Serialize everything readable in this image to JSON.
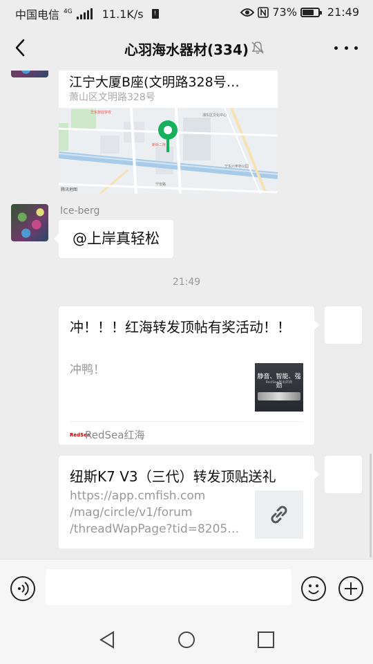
{
  "status_bar": {
    "carrier": "中国电信",
    "network_type": "4G",
    "speed": "11.1K/s",
    "battery": "73%",
    "battery_level": 0.73,
    "time": "21:49",
    "icons": [
      "signal-icon",
      "sim-alert-icon",
      "eye-icon",
      "nfc-icon",
      "battery-icon"
    ]
  },
  "header": {
    "title": "心羽海水器材(334)",
    "icons": [
      "back-icon",
      "mute-icon",
      "more-icon"
    ]
  },
  "messages": {
    "location": {
      "title": "江宁大厦B座(文明路328号…",
      "address": "萧山区文明路328号",
      "map_labels": {
        "school": "华东数控学校",
        "community": "湘东区文化中心",
        "hospital": "新街二院",
        "park": "宁东六甲桥公园",
        "river_road": "宁安路",
        "provider": "腾讯地图"
      }
    },
    "iceberg": {
      "sender": "Ice-berg",
      "text": "@上岸真轻松"
    },
    "time_divider": "21:49",
    "share1": {
      "title": "冲！！！红海转发顶帖有奖活动！！",
      "desc": "冲鸭！",
      "thumb_text": "静音、智能、强劲",
      "thumb_sub": "RedSea推出的新",
      "source_logo": "RedSea",
      "source": "RedSea红海"
    },
    "share2": {
      "title": "纽斯K7 V3（三代）转发顶贴送礼",
      "desc_lines": [
        "https://app.cmfish.com",
        "/mag/circle/v1/forum",
        "/threadWapPage?tid=8205…"
      ]
    }
  },
  "input_bar": {
    "placeholder": "",
    "icons": [
      "voice-icon",
      "emoji-icon",
      "plus-icon"
    ]
  },
  "nav_bar": {
    "icons": [
      "nav-back-icon",
      "nav-home-icon",
      "nav-recents-icon"
    ]
  },
  "colors": {
    "background": "#ededed",
    "bubble": "#ffffff",
    "map_pin": "#16b05f",
    "text_primary": "#111111",
    "text_secondary": "#999999"
  }
}
